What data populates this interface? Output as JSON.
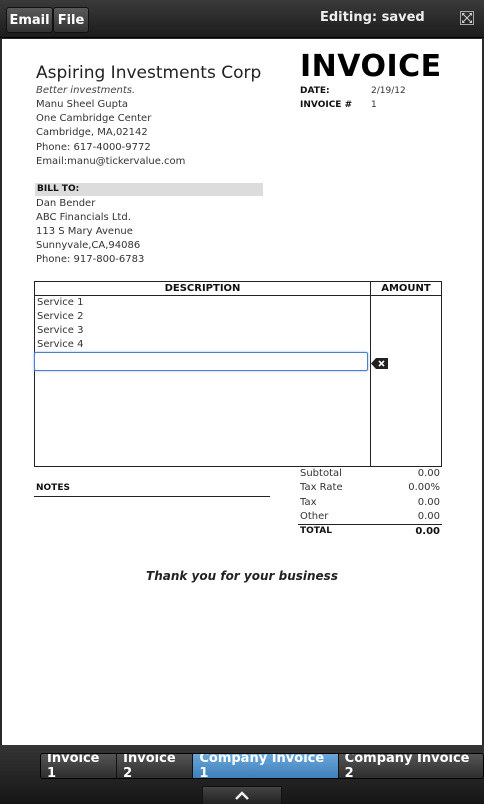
{
  "toolbar": {
    "email_label": "Email",
    "file_label": "File",
    "status": "Editing: saved",
    "expand_icon": "expand-icon"
  },
  "company": {
    "name": "Aspiring Investments Corp",
    "tagline": "Better investments.",
    "contact": "Manu Sheel Gupta",
    "street": "One Cambridge Center",
    "city": "Cambridge, MA,02142",
    "phone": "Phone: 617-4000-9772",
    "email": "Email:manu@tickervalue.com"
  },
  "invoice": {
    "title": "INVOICE",
    "date_label": "DATE:",
    "date_value": "2/19/12",
    "number_label": "INVOICE #",
    "number_value": "1"
  },
  "bill_to": {
    "label": "BILL TO:",
    "name": "Dan Bender",
    "company": "ABC Financials Ltd.",
    "street": "113 S Mary Avenue",
    "city": "Sunnyvale,CA,94086",
    "phone": "Phone: 917-800-6783"
  },
  "table": {
    "headers": [
      "DESCRIPTION",
      "AMOUNT"
    ],
    "rows": [
      "Service 1",
      "Service 2",
      "Service 3",
      "Service 4"
    ],
    "edit_value": ""
  },
  "notes": {
    "label": "NOTES"
  },
  "totals": {
    "subtotal_label": "Subtotal",
    "subtotal_value": "0.00",
    "taxrate_label": "Tax Rate",
    "taxrate_value": "0.00%",
    "tax_label": "Tax",
    "tax_value": "0.00",
    "other_label": "Other",
    "other_value": "0.00",
    "total_label": "TOTAL",
    "total_value": "0.00"
  },
  "footer": {
    "thanks": "Thank you for your business"
  },
  "tabs": [
    {
      "label": "Invoice 1",
      "active": false
    },
    {
      "label": "Invoice 2",
      "active": false
    },
    {
      "label": "Company Invoice 1",
      "active": true
    },
    {
      "label": "Company Invoice 2",
      "active": false
    }
  ],
  "colors": {
    "active_tab": "#4a8fd0",
    "input_focus": "#4a7fd0"
  }
}
